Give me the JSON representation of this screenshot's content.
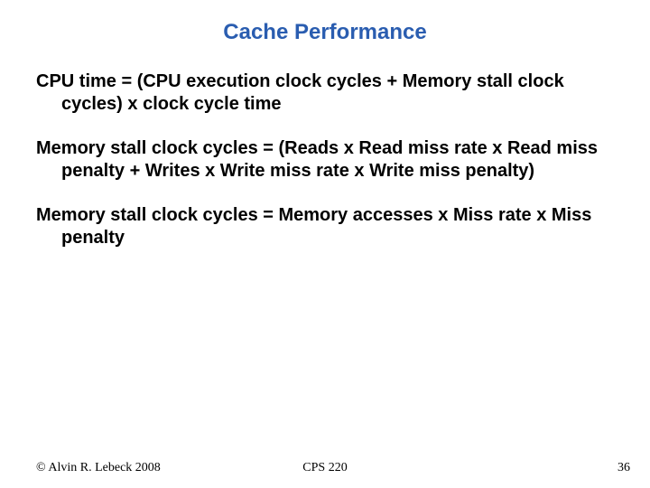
{
  "title": "Cache Performance",
  "paragraphs": [
    "CPU time = (CPU execution clock cycles + Memory stall clock cycles) x clock cycle time",
    "Memory stall clock cycles = (Reads x Read miss rate x Read miss penalty + Writes x Write miss rate x Write miss penalty)",
    "Memory stall clock cycles = Memory accesses x Miss rate x Miss penalty"
  ],
  "footer": {
    "left": "© Alvin R. Lebeck 2008",
    "center": "CPS 220",
    "right": "36"
  }
}
